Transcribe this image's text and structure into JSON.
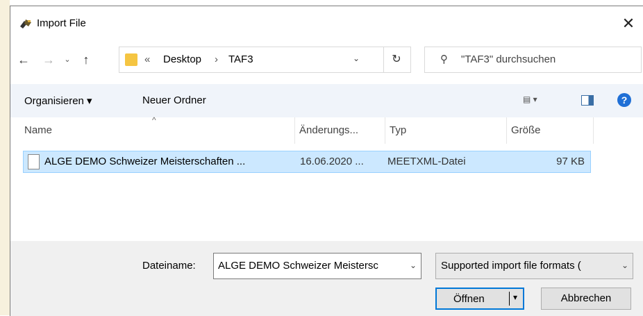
{
  "dialog": {
    "title": "Import File",
    "close_glyph": "✕"
  },
  "nav": {
    "back": "←",
    "forward": "→",
    "recent": "⌄",
    "up": "↑",
    "breadcrumb_prefix": "«",
    "breadcrumbs": [
      "Desktop",
      "TAF3"
    ],
    "breadcrumb_sep": "›",
    "dropdown": "⌄",
    "refresh": "↻",
    "search_placeholder": "\"TAF3\" durchsuchen"
  },
  "toolbar": {
    "organise_label": "Organisieren ▾",
    "new_folder_label": "Neuer Ordner",
    "help_glyph": "?"
  },
  "columns": {
    "name": "Name",
    "date": "Änderungs...",
    "type": "Typ",
    "size": "Größe",
    "sort_caret": "^"
  },
  "files": [
    {
      "name": "ALGE DEMO Schweizer Meisterschaften ...",
      "date": "16.06.2020 ...",
      "type": "MEETXML-Datei",
      "size": "97 KB"
    }
  ],
  "bottom": {
    "filename_label": "Dateiname:",
    "filename_value": "ALGE DEMO Schweizer Meistersc",
    "filetype_value": "Supported import file formats (",
    "combo_arrow": "⌄",
    "open_label": "Öffnen",
    "open_arrow": "▾",
    "cancel_label": "Abbrechen"
  },
  "colors": {
    "accent": "#0078d7",
    "selection": "#cce8ff",
    "folder": "#f5c542",
    "help": "#1f6fd6"
  },
  "icons": [
    "app-icon",
    "back-arrow-icon",
    "forward-arrow-icon",
    "up-arrow-icon",
    "folder-icon",
    "refresh-icon",
    "search-icon",
    "view-options-icon",
    "preview-pane-icon",
    "help-icon",
    "file-icon"
  ]
}
